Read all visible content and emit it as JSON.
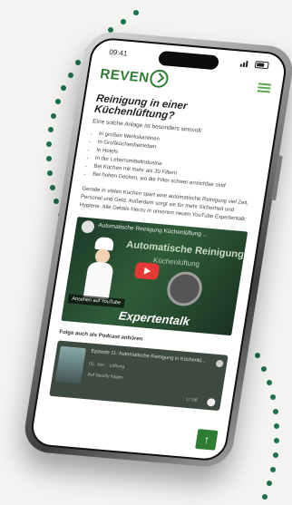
{
  "status": {
    "time": "09:41"
  },
  "brand": {
    "name": "REVEN"
  },
  "article": {
    "title": "Reinigung in einer Küchenlüftung?",
    "subtitle": "Eine solche Anlage ist besonders sinnvoll:",
    "bullets": [
      "In großen Werkskantinen",
      "In Großküchenbetrieben",
      "In Hotels",
      "In der Lebensmittelindustrie",
      "Bei Küchen mit mehr als 30 Filtern",
      "Bei hohen Decken, wo die Filter schwer erreichbar sind"
    ],
    "paragraph": "Gerade in vielen Küchen spart eine automatische Reinigung viel Zeit, Personal und Geld. Außerdem sorgt sie für mehr Sicherheit und Hygiene. Alle Details hierzu in unserem neuen YouTube Expertentalk:"
  },
  "video": {
    "title": "Automatische Reinigung Küchenlüftung ...",
    "overlay_line1": "Automatische Reinigung",
    "overlay_line2": "Küchenlüftung",
    "watch_label": "Ansehen auf YouTube",
    "badge": "Expertentalk"
  },
  "podcast": {
    "heading": "Folge auch als Podcast anhören",
    "episode_title": "Episode 11: Automatische Reinigung in Küchenlü...",
    "meta": "01. Jan. · Lüftung",
    "follow_label": "Auf Spotify folgen",
    "duration": "17:08"
  },
  "colors": {
    "brand": "#2e7d32",
    "dots": "#1f6f4a"
  }
}
